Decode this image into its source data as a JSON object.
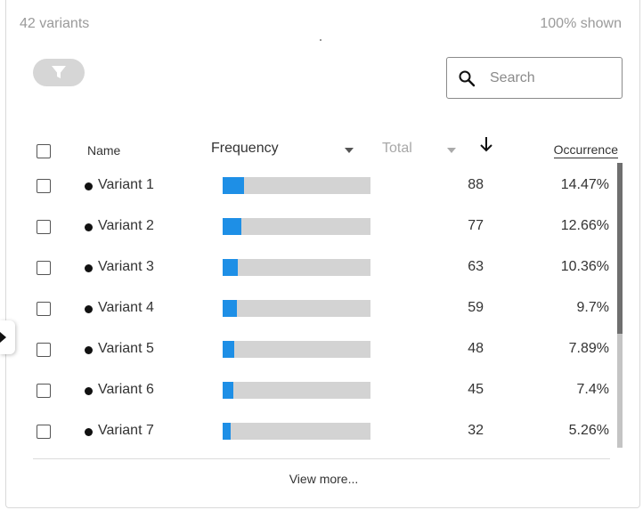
{
  "header": {
    "variants_count": "42 variants",
    "shown_percent": "100% shown"
  },
  "search": {
    "placeholder": "Search",
    "value": ""
  },
  "icons": {
    "filter": "filter-icon",
    "search": "search-icon",
    "sort": "arrow-down-icon",
    "panel_toggle": "chevron-right-icon"
  },
  "table": {
    "columns": {
      "name": "Name",
      "frequency": "Frequency",
      "total": "Total",
      "occurrence": "Occurrence"
    },
    "sorted_by": "Total",
    "sort_direction": "descending",
    "rows": [
      {
        "name": "Variant 1",
        "total": "88",
        "occurrence": "14.47%",
        "frequency_fraction": 0.1447
      },
      {
        "name": "Variant 2",
        "total": "77",
        "occurrence": "12.66%",
        "frequency_fraction": 0.1266
      },
      {
        "name": "Variant 3",
        "total": "63",
        "occurrence": "10.36%",
        "frequency_fraction": 0.1036
      },
      {
        "name": "Variant 4",
        "total": "59",
        "occurrence": "9.7%",
        "frequency_fraction": 0.097
      },
      {
        "name": "Variant 5",
        "total": "48",
        "occurrence": "7.89%",
        "frequency_fraction": 0.0789
      },
      {
        "name": "Variant 6",
        "total": "45",
        "occurrence": "7.4%",
        "frequency_fraction": 0.074
      },
      {
        "name": "Variant 7",
        "total": "32",
        "occurrence": "5.26%",
        "frequency_fraction": 0.0526
      }
    ]
  },
  "footer": {
    "view_more": "View more..."
  },
  "colors": {
    "bar_fill": "#1e8fe6",
    "bar_track": "#d3d3d3",
    "scroll_thumb": "#6f6f6f"
  }
}
